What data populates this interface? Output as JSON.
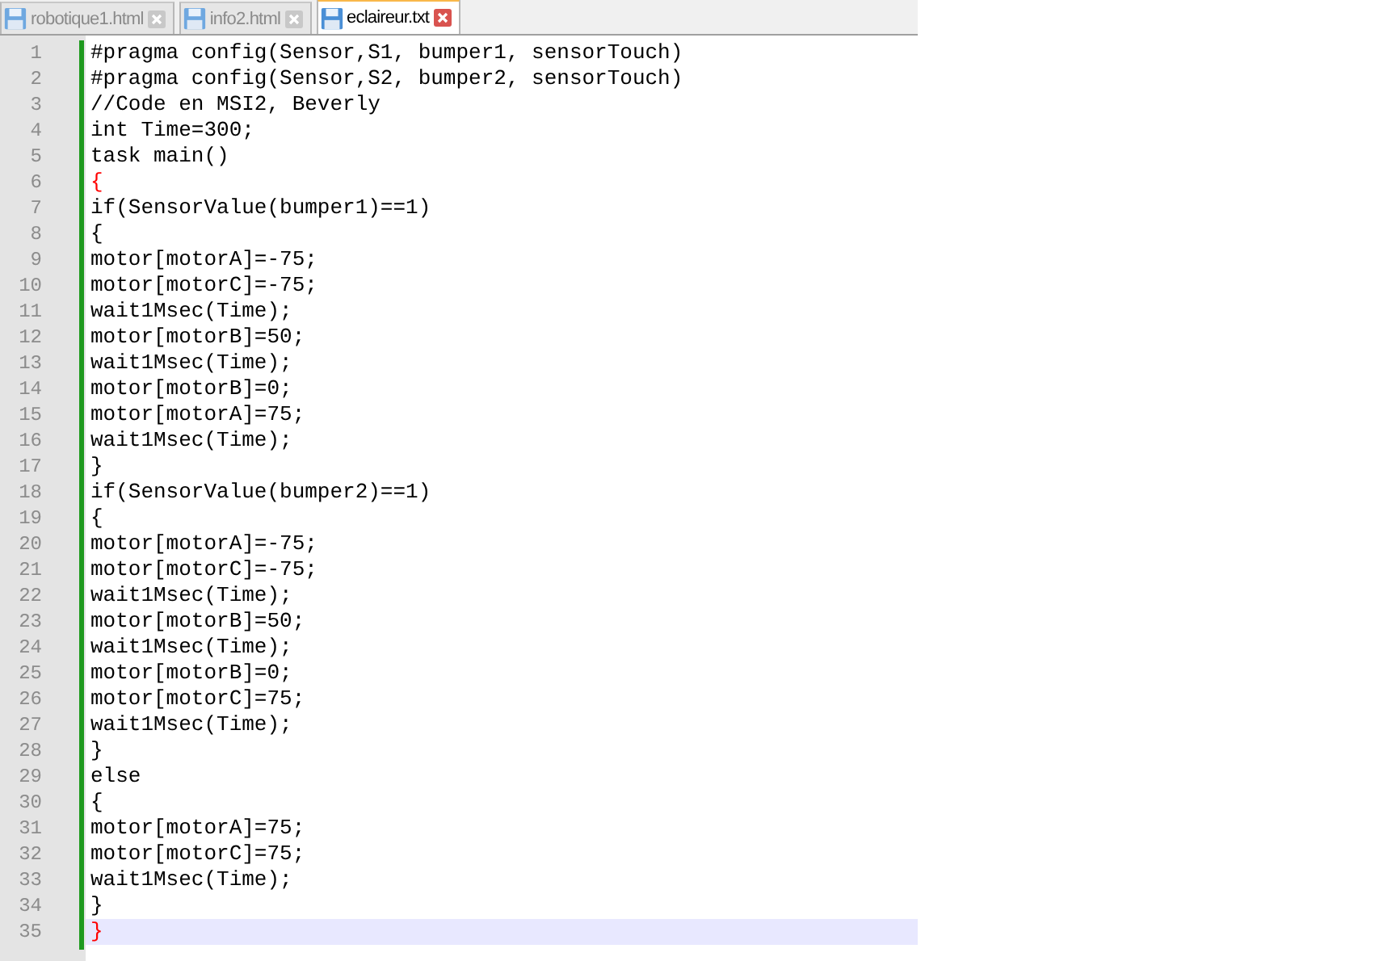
{
  "tabs": [
    {
      "label": "robotique1.html",
      "selected": false
    },
    {
      "label": "info2.html",
      "selected": false
    },
    {
      "label": "eclaireur.txt",
      "selected": true
    }
  ],
  "lines": [
    {
      "number": "1",
      "text": "#pragma config(Sensor,S1, bumper1, sensorTouch)",
      "brace_match": false,
      "current": false
    },
    {
      "number": "2",
      "text": "#pragma config(Sensor,S2, bumper2, sensorTouch)",
      "brace_match": false,
      "current": false
    },
    {
      "number": "3",
      "text": "//Code en MSI2, Beverly",
      "brace_match": false,
      "current": false
    },
    {
      "number": "4",
      "text": "int Time=300;",
      "brace_match": false,
      "current": false
    },
    {
      "number": "5",
      "text": "task main()",
      "brace_match": false,
      "current": false
    },
    {
      "number": "6",
      "text": "{",
      "brace_match": true,
      "current": false
    },
    {
      "number": "7",
      "text": "if(SensorValue(bumper1)==1)",
      "brace_match": false,
      "current": false
    },
    {
      "number": "8",
      "text": "{",
      "brace_match": false,
      "current": false
    },
    {
      "number": "9",
      "text": "motor[motorA]=-75;",
      "brace_match": false,
      "current": false
    },
    {
      "number": "10",
      "text": "motor[motorC]=-75;",
      "brace_match": false,
      "current": false
    },
    {
      "number": "11",
      "text": "wait1Msec(Time);",
      "brace_match": false,
      "current": false
    },
    {
      "number": "12",
      "text": "motor[motorB]=50;",
      "brace_match": false,
      "current": false
    },
    {
      "number": "13",
      "text": "wait1Msec(Time);",
      "brace_match": false,
      "current": false
    },
    {
      "number": "14",
      "text": "motor[motorB]=0;",
      "brace_match": false,
      "current": false
    },
    {
      "number": "15",
      "text": "motor[motorA]=75;",
      "brace_match": false,
      "current": false
    },
    {
      "number": "16",
      "text": "wait1Msec(Time);",
      "brace_match": false,
      "current": false
    },
    {
      "number": "17",
      "text": "}",
      "brace_match": false,
      "current": false
    },
    {
      "number": "18",
      "text": "if(SensorValue(bumper2)==1)",
      "brace_match": false,
      "current": false
    },
    {
      "number": "19",
      "text": "{",
      "brace_match": false,
      "current": false
    },
    {
      "number": "20",
      "text": "motor[motorA]=-75;",
      "brace_match": false,
      "current": false
    },
    {
      "number": "21",
      "text": "motor[motorC]=-75;",
      "brace_match": false,
      "current": false
    },
    {
      "number": "22",
      "text": "wait1Msec(Time);",
      "brace_match": false,
      "current": false
    },
    {
      "number": "23",
      "text": "motor[motorB]=50;",
      "brace_match": false,
      "current": false
    },
    {
      "number": "24",
      "text": "wait1Msec(Time);",
      "brace_match": false,
      "current": false
    },
    {
      "number": "25",
      "text": "motor[motorB]=0;",
      "brace_match": false,
      "current": false
    },
    {
      "number": "26",
      "text": "motor[motorC]=75;",
      "brace_match": false,
      "current": false
    },
    {
      "number": "27",
      "text": "wait1Msec(Time);",
      "brace_match": false,
      "current": false
    },
    {
      "number": "28",
      "text": "}",
      "brace_match": false,
      "current": false
    },
    {
      "number": "29",
      "text": "else",
      "brace_match": false,
      "current": false
    },
    {
      "number": "30",
      "text": "{",
      "brace_match": false,
      "current": false
    },
    {
      "number": "31",
      "text": "motor[motorA]=75;",
      "brace_match": false,
      "current": false
    },
    {
      "number": "32",
      "text": "motor[motorC]=75;",
      "brace_match": false,
      "current": false
    },
    {
      "number": "33",
      "text": "wait1Msec(Time);",
      "brace_match": false,
      "current": false
    },
    {
      "number": "34",
      "text": "}",
      "brace_match": false,
      "current": false
    },
    {
      "number": "35",
      "text": "}",
      "brace_match": true,
      "current": true
    }
  ]
}
